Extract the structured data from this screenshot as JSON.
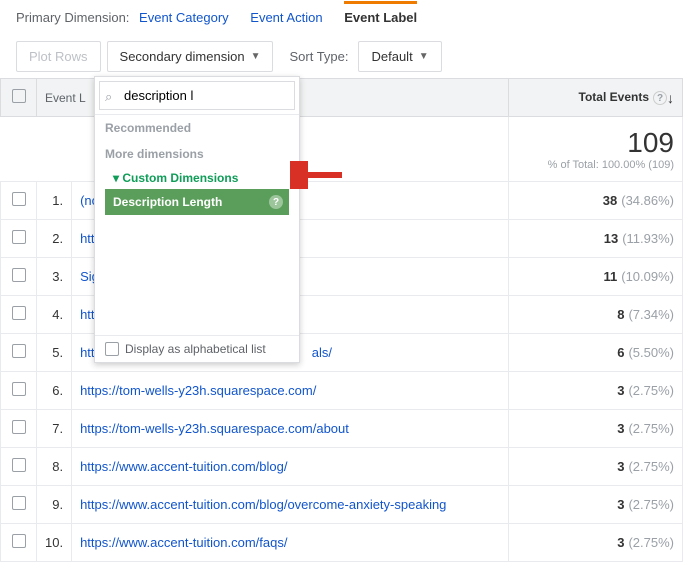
{
  "primary": {
    "label": "Primary Dimension:",
    "items": [
      "Event Category",
      "Event Action",
      "Event Label"
    ],
    "activeIndex": 2
  },
  "toolbar": {
    "plotRows": "Plot Rows",
    "secondary": "Secondary dimension",
    "sortLabel": "Sort Type:",
    "sortValue": "Default"
  },
  "dropdown": {
    "searchValue": "description l",
    "recommended": "Recommended",
    "more": "More dimensions",
    "custom": "Custom Dimensions",
    "item": "Description Length",
    "foot": "Display as alphabetical list"
  },
  "header": {
    "eventLabel": "Event L",
    "totalEvents": "Total Events"
  },
  "summary": {
    "total": "109",
    "sub": "% of Total: 100.00% (109)"
  },
  "rows": [
    {
      "idx": "1.",
      "label": "(no",
      "events": "38",
      "pct": "(34.86%)"
    },
    {
      "idx": "2.",
      "label": "http",
      "events": "13",
      "pct": "(11.93%)"
    },
    {
      "idx": "3.",
      "label": "Sig",
      "events": "11",
      "pct": "(10.09%)"
    },
    {
      "idx": "4.",
      "label": "http",
      "events": "8",
      "pct": "(7.34%)"
    },
    {
      "idx": "5.",
      "label": "http",
      "tail": "als/",
      "events": "6",
      "pct": "(5.50%)"
    },
    {
      "idx": "6.",
      "label": "https://tom-wells-y23h.squarespace.com/",
      "events": "3",
      "pct": "(2.75%)"
    },
    {
      "idx": "7.",
      "label": "https://tom-wells-y23h.squarespace.com/about",
      "events": "3",
      "pct": "(2.75%)"
    },
    {
      "idx": "8.",
      "label": "https://www.accent-tuition.com/blog/",
      "events": "3",
      "pct": "(2.75%)"
    },
    {
      "idx": "9.",
      "label": "https://www.accent-tuition.com/blog/overcome-anxiety-speaking",
      "events": "3",
      "pct": "(2.75%)"
    },
    {
      "idx": "10.",
      "label": "https://www.accent-tuition.com/faqs/",
      "events": "3",
      "pct": "(2.75%)"
    }
  ]
}
